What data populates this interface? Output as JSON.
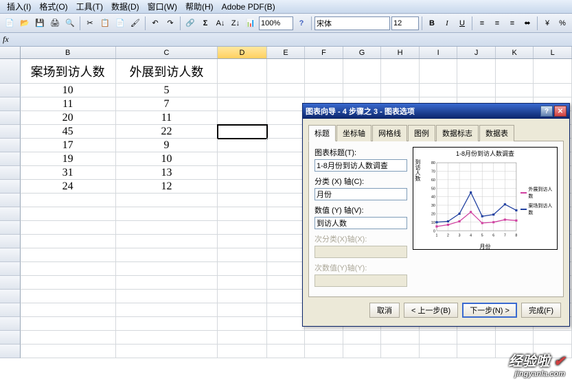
{
  "menu": {
    "items": [
      "插入(I)",
      "格式(O)",
      "工具(T)",
      "数据(D)",
      "窗口(W)",
      "帮助(H)",
      "Adobe PDF(B)"
    ]
  },
  "toolbar": {
    "zoom": "100%",
    "font_name": "宋体",
    "font_size": "12"
  },
  "active_cell": "D",
  "columns": [
    "B",
    "C",
    "D",
    "E",
    "F",
    "G",
    "H",
    "I",
    "J",
    "K",
    "L"
  ],
  "sheet": {
    "header": {
      "B": "案场到访人数",
      "C": "外展到访人数"
    },
    "rows": [
      {
        "B": "10",
        "C": "5"
      },
      {
        "B": "11",
        "C": "7"
      },
      {
        "B": "20",
        "C": "11"
      },
      {
        "B": "45",
        "C": "22"
      },
      {
        "B": "17",
        "C": "9"
      },
      {
        "B": "19",
        "C": "10"
      },
      {
        "B": "31",
        "C": "13"
      },
      {
        "B": "24",
        "C": "12"
      }
    ]
  },
  "dialog": {
    "title": "图表向导 - 4 步骤之 3 - 图表选项",
    "tabs": [
      "标题",
      "坐标轴",
      "网格线",
      "图例",
      "数据标志",
      "数据表"
    ],
    "active_tab": 0,
    "fields": {
      "chart_title_label": "图表标题(T):",
      "chart_title_value": "1-8月份到访人数调查",
      "x_axis_label": "分类 (X) 轴(C):",
      "x_axis_value": "月份",
      "y_axis_label": "数值 (Y) 轴(V):",
      "y_axis_value": "到访人数",
      "x2_label": "次分类(X)轴(X):",
      "y2_label": "次数值(Y)轴(Y):"
    },
    "preview": {
      "title": "1-8月份到访人数调查",
      "ylabel": "到访人数",
      "xlabel": "月份",
      "legend": [
        "外展到访人数",
        "案场到访人数"
      ]
    },
    "buttons": {
      "cancel": "取消",
      "back": "< 上一步(B)",
      "next": "下一步(N) >",
      "finish": "完成(F)"
    }
  },
  "chart_data": {
    "type": "line",
    "title": "1-8月份到访人数调查",
    "xlabel": "月份",
    "ylabel": "到访人数",
    "categories": [
      1,
      2,
      3,
      4,
      5,
      6,
      7,
      8
    ],
    "ylim": [
      0,
      80
    ],
    "yticks": [
      0,
      10,
      20,
      30,
      40,
      50,
      60,
      70,
      80
    ],
    "series": [
      {
        "name": "外展到访人数",
        "color": "#d040a0",
        "values": [
          5,
          7,
          11,
          22,
          9,
          10,
          13,
          12
        ]
      },
      {
        "name": "案场到访人数",
        "color": "#2040a0",
        "values": [
          10,
          11,
          20,
          45,
          17,
          19,
          31,
          24
        ]
      }
    ]
  },
  "watermark": {
    "text": "经验啦",
    "url": "jingyanla.com"
  }
}
